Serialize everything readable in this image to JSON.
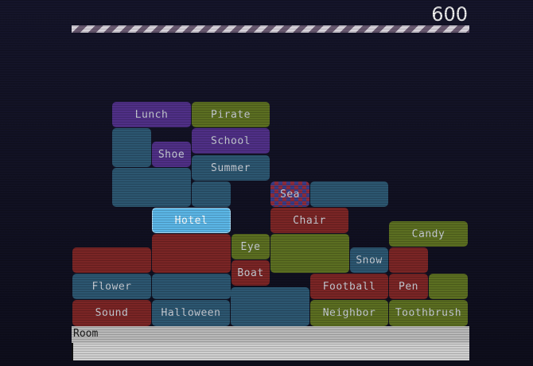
{
  "score": "600",
  "target_word": "Room",
  "input": {
    "value": "",
    "placeholder": ""
  },
  "blocks": [
    {
      "id": "lunch",
      "label": "Lunch",
      "color": "purple"
    },
    {
      "id": "pirate",
      "label": "Pirate",
      "color": "olive"
    },
    {
      "id": "shoe",
      "label": "Shoe",
      "color": "purple"
    },
    {
      "id": "school",
      "label": "School",
      "color": "purple"
    },
    {
      "id": "summer",
      "label": "Summer",
      "color": "blue"
    },
    {
      "id": "sea",
      "label": "Sea",
      "color": "checker"
    },
    {
      "id": "hotel",
      "label": "Hotel",
      "color": "active"
    },
    {
      "id": "chair",
      "label": "Chair",
      "color": "red"
    },
    {
      "id": "candy",
      "label": "Candy",
      "color": "olive"
    },
    {
      "id": "eye",
      "label": "Eye",
      "color": "olive"
    },
    {
      "id": "snow",
      "label": "Snow",
      "color": "blue"
    },
    {
      "id": "boat",
      "label": "Boat",
      "color": "red"
    },
    {
      "id": "flower",
      "label": "Flower",
      "color": "blue"
    },
    {
      "id": "football",
      "label": "Football",
      "color": "red"
    },
    {
      "id": "pen",
      "label": "Pen",
      "color": "red"
    },
    {
      "id": "sound",
      "label": "Sound",
      "color": "red"
    },
    {
      "id": "halloween",
      "label": "Halloween",
      "color": "blue"
    },
    {
      "id": "neighbor",
      "label": "Neighbor",
      "color": "olive"
    },
    {
      "id": "toothbrush",
      "label": "Toothbrush",
      "color": "olive"
    }
  ]
}
